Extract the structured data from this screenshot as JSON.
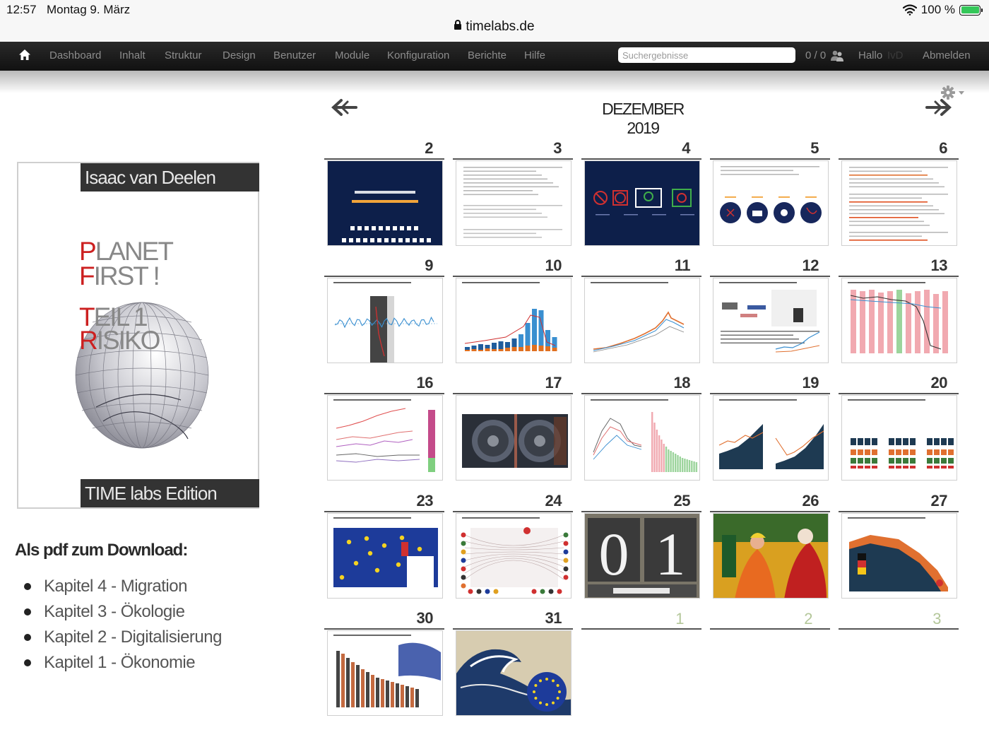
{
  "statusbar": {
    "time": "12:57",
    "date": "Montag 9. März",
    "url": "timelabs.de",
    "battery": "100 %"
  },
  "nav": {
    "items": [
      "Dashboard",
      "Inhalt",
      "Struktur",
      "Design",
      "Benutzer",
      "Module",
      "Konfiguration",
      "Berichte",
      "Hilfe"
    ],
    "search_placeholder": "Suchergebnisse",
    "counter": "0 / 0",
    "hello": "Hallo",
    "user": "IvD",
    "logout": "Abmelden"
  },
  "book": {
    "author": "Isaac van Deelen",
    "title_line1_cap": "P",
    "title_line1_rest": "LANET",
    "title_line2_cap": "F",
    "title_line2_rest": "IRST !",
    "title_line3_cap": "T",
    "title_line3_rest": "EIL 1",
    "title_line4_cap": "R",
    "title_line4_rest": "ISIKO",
    "edition": "TIME labs Edition"
  },
  "downloads": {
    "heading": "Als pdf zum Download:",
    "items": [
      "Kapitel 4 - Migration",
      "Kapitel 3 - Ökologie",
      "Kapitel 2 - Digitalisierung",
      "Kapitel 1 - Ökonomie"
    ]
  },
  "calendar": {
    "title": "DEZEMBER 2019",
    "cells": [
      {
        "day": "2",
        "kind": "cover-dark"
      },
      {
        "day": "3",
        "kind": "text"
      },
      {
        "day": "4",
        "kind": "icons-dark"
      },
      {
        "day": "5",
        "kind": "circles"
      },
      {
        "day": "6",
        "kind": "text-red"
      },
      {
        "day": "9",
        "kind": "line-band"
      },
      {
        "day": "10",
        "kind": "bars-rise"
      },
      {
        "day": "11",
        "kind": "line-rise"
      },
      {
        "day": "12",
        "kind": "ratings"
      },
      {
        "day": "13",
        "kind": "bars-pink"
      },
      {
        "day": "16",
        "kind": "multi-lines"
      },
      {
        "day": "17",
        "kind": "vault"
      },
      {
        "day": "18",
        "kind": "bars-pink-green"
      },
      {
        "day": "19",
        "kind": "area-dark"
      },
      {
        "day": "20",
        "kind": "grouped-bars"
      },
      {
        "day": "23",
        "kind": "eu-flag"
      },
      {
        "day": "24",
        "kind": "network"
      },
      {
        "day": "25",
        "kind": "april"
      },
      {
        "day": "26",
        "kind": "painting"
      },
      {
        "day": "27",
        "kind": "area-flag"
      },
      {
        "day": "30",
        "kind": "bars-dark"
      },
      {
        "day": "31",
        "kind": "wave"
      },
      {
        "day": "1",
        "kind": "next"
      },
      {
        "day": "2",
        "kind": "next"
      },
      {
        "day": "3",
        "kind": "next"
      }
    ]
  },
  "colors": {
    "navbar": "#1a1a1a",
    "nav_text": "#8c8c8c",
    "accent_red": "#cc2020",
    "next_month_day": "#b4c79a",
    "dark_navy": "#0d1f4a"
  }
}
